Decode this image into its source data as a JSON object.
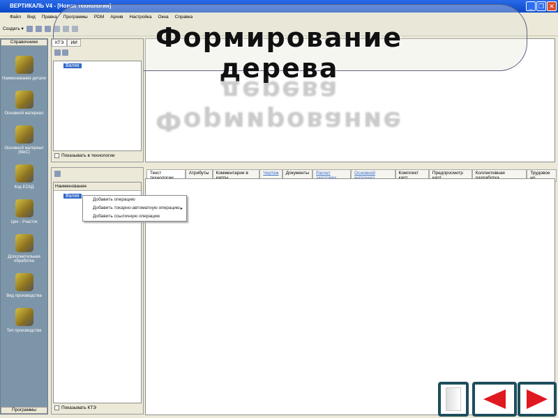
{
  "window": {
    "title": "ВЕРТИКАЛЬ V4 - [Новая технология]"
  },
  "menu": [
    "Файл",
    "Вид",
    "Правка",
    "Программы",
    "PDM",
    "Архив",
    "Настройка",
    "Окна",
    "Справка"
  ],
  "toolbar": {
    "create_label": "Создать ▾"
  },
  "sidebar": {
    "header": "Справочники",
    "footer": "Программы",
    "items": [
      "Наименование детали",
      "Основной материал",
      "Основной материал (МиС)",
      "Код ЕСКД",
      "Цех - Участок",
      "Дополнительная обработка",
      "Вид производства",
      "Тип производства"
    ]
  },
  "upper_panel": {
    "tabs": [
      "КТЭ",
      "ИИ"
    ],
    "tree_item": "Валик",
    "checkbox_label": "Показывать в технологии"
  },
  "lower_panel": {
    "column_header": "Наименование",
    "tree_item": "Валик",
    "checkbox_label": "Показывать КТЭ"
  },
  "context_menu": [
    "Добавить операцию",
    "Добавить токарно-автоматную операцию",
    "Добавить ссылочную операцию"
  ],
  "doc_tabs": [
    {
      "label": "Текст технологии",
      "link": false
    },
    {
      "label": "Атрибуты",
      "link": false
    },
    {
      "label": "Комментарии в карты",
      "link": false
    },
    {
      "label": "Чертеж",
      "link": true
    },
    {
      "label": "Документы",
      "link": false
    },
    {
      "label": "Расчет заготовки",
      "link": true
    },
    {
      "label": "Основной материал",
      "link": true
    },
    {
      "label": "Комплект карт",
      "link": false
    },
    {
      "label": "Предпросмотр карт",
      "link": false
    },
    {
      "label": "Коллективная разработка",
      "link": false
    },
    {
      "label": "Трудовое но",
      "link": false
    }
  ],
  "slide": {
    "headline": "Формирование дерева"
  }
}
